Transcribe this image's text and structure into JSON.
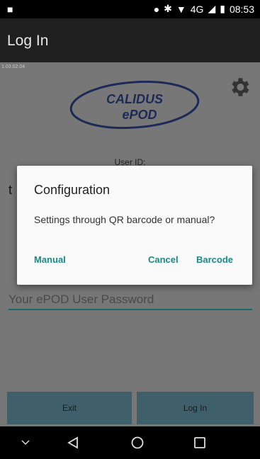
{
  "status_bar": {
    "network": "4G",
    "time": "08:53"
  },
  "app_bar": {
    "title": "Log In"
  },
  "login": {
    "version": "1.03.02.04",
    "logo_top": "CALIDUS",
    "logo_bottom": "ePOD",
    "userid_label": "User ID:",
    "userid_value_partial": "t",
    "password_placeholder": "Your ePOD User Password",
    "exit_label": "Exit",
    "login_label": "Log In"
  },
  "dialog": {
    "title": "Configuration",
    "message": "Settings through QR barcode or manual?",
    "manual_label": "Manual",
    "cancel_label": "Cancel",
    "barcode_label": "Barcode"
  },
  "colors": {
    "accent": "#1a8a86",
    "dialog_bg": "#fafafa",
    "app_bar": "#1f1f1f"
  }
}
